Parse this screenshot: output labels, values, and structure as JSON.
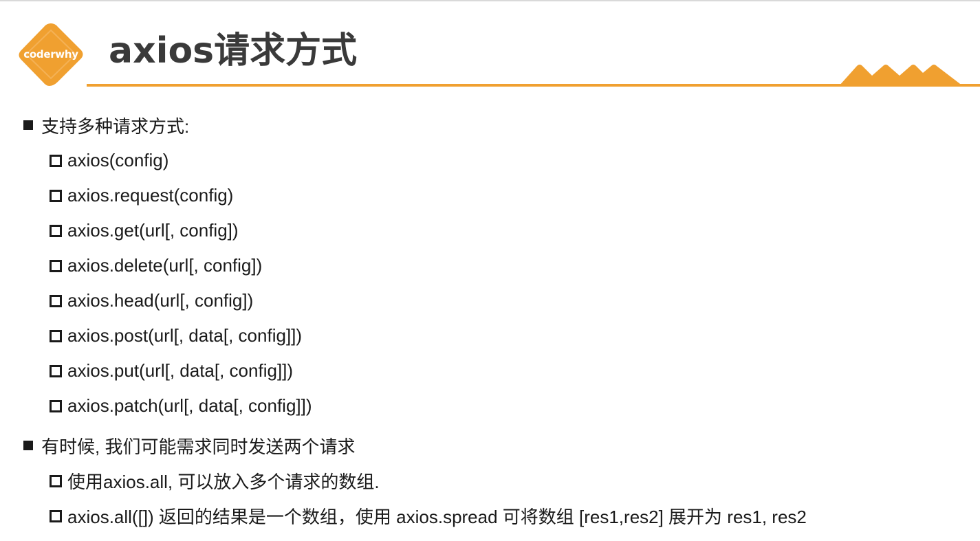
{
  "logo": {
    "text": "coderwhy"
  },
  "header": {
    "title": "axios请求方式"
  },
  "colors": {
    "accent": "#f0a030",
    "title": "#3a3a3a",
    "text": "#1a1a1a"
  },
  "sections": [
    {
      "heading": "支持多种请求方式:",
      "items": [
        "axios(config)",
        "axios.request(config)",
        "axios.get(url[, config])",
        "axios.delete(url[, config])",
        "axios.head(url[, config])",
        "axios.post(url[, data[, config]])",
        "axios.put(url[, data[, config]])",
        "axios.patch(url[, data[, config]])"
      ]
    },
    {
      "heading": "有时候, 我们可能需求同时发送两个请求",
      "items": [
        "使用axios.all, 可以放入多个请求的数组.",
        "axios.all([]) 返回的结果是一个数组，使用 axios.spread 可将数组 [res1,res2] 展开为 res1, res2"
      ]
    }
  ]
}
